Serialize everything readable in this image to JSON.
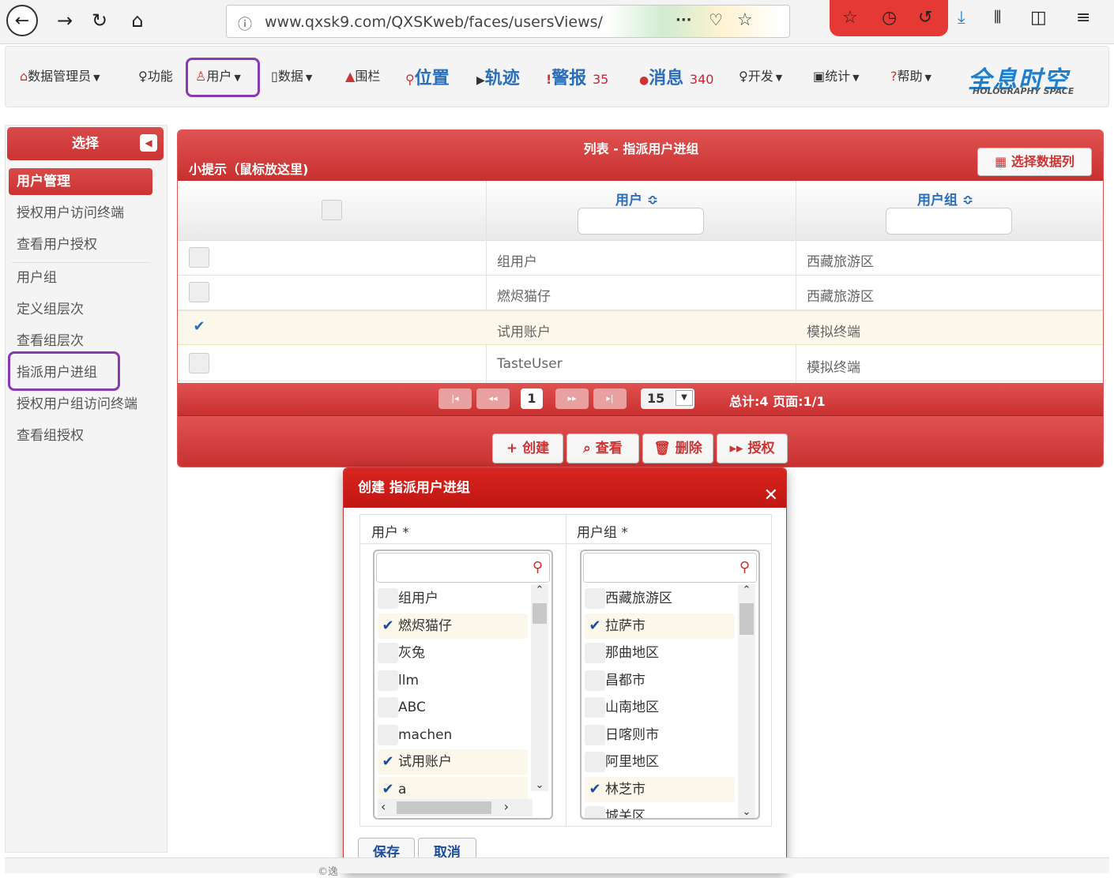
{
  "browser": {
    "url": "www.qxsk9.com/QXSKweb/faces/usersViews/"
  },
  "nav": {
    "admin": "数据管理员",
    "func": "功能",
    "user": "用户",
    "data": "数据",
    "fence": "围栏",
    "location": "位置",
    "track": "轨迹",
    "alarm": "警报",
    "alarm_count": "35",
    "message": "消息",
    "message_count": "340",
    "dev": "开发",
    "stats": "统计",
    "help": "帮助"
  },
  "logo": {
    "cn": "全息时空",
    "en": "HOLOGRAPHY SPACE"
  },
  "sidebar": {
    "title": "选择",
    "items": [
      {
        "label": "用户管理"
      },
      {
        "label": "授权用户访问终端"
      },
      {
        "label": "查看用户授权"
      },
      {
        "label": "用户组"
      },
      {
        "label": "定义组层次"
      },
      {
        "label": "查看组层次"
      },
      {
        "label": "指派用户进组"
      },
      {
        "label": "授权用户组访问终端"
      },
      {
        "label": "查看组授权"
      }
    ]
  },
  "panel": {
    "title": "列表 - 指派用户进组",
    "tip": "小提示（鼠标放这里)",
    "select_columns": "选择数据列",
    "columns": [
      "用户 ≎",
      "用户组 ≎"
    ],
    "rows": [
      {
        "user": "组用户",
        "group": "西藏旅游区",
        "checked": false
      },
      {
        "user": "燃烬猫仔",
        "group": "西藏旅游区",
        "checked": false
      },
      {
        "user": "试用账户",
        "group": "模拟终端",
        "checked": true
      },
      {
        "user": "TasteUser",
        "group": "模拟终端",
        "checked": false
      }
    ],
    "pager": {
      "current": "1",
      "page_size": "15",
      "total": "总计:4 页面:1/1"
    },
    "actions": {
      "create": "+ 创建",
      "view": "⌕ 查看",
      "delete": "🗑 删除",
      "grant": "▸▸ 授权"
    }
  },
  "dialog": {
    "title": "创建 指派用户进组",
    "user_label": "用户 *",
    "group_label": "用户组 *",
    "users": [
      {
        "label": "组用户",
        "checked": false
      },
      {
        "label": "燃烬猫仔",
        "checked": true
      },
      {
        "label": "灰兔",
        "checked": false
      },
      {
        "label": "llm",
        "checked": false
      },
      {
        "label": "ABC",
        "checked": false
      },
      {
        "label": "machen",
        "checked": false
      },
      {
        "label": "试用账户",
        "checked": true
      },
      {
        "label": "a",
        "checked": true
      }
    ],
    "groups": [
      {
        "label": "西藏旅游区",
        "checked": false
      },
      {
        "label": "拉萨市",
        "checked": true
      },
      {
        "label": "那曲地区",
        "checked": false
      },
      {
        "label": "昌都市",
        "checked": false
      },
      {
        "label": "山南地区",
        "checked": false
      },
      {
        "label": "日喀则市",
        "checked": false
      },
      {
        "label": "阿里地区",
        "checked": false
      },
      {
        "label": "林芝市",
        "checked": true
      },
      {
        "label": "城关区",
        "checked": false
      }
    ],
    "save": "保存",
    "cancel": "取消"
  },
  "footer": {
    "text": "©逸"
  }
}
